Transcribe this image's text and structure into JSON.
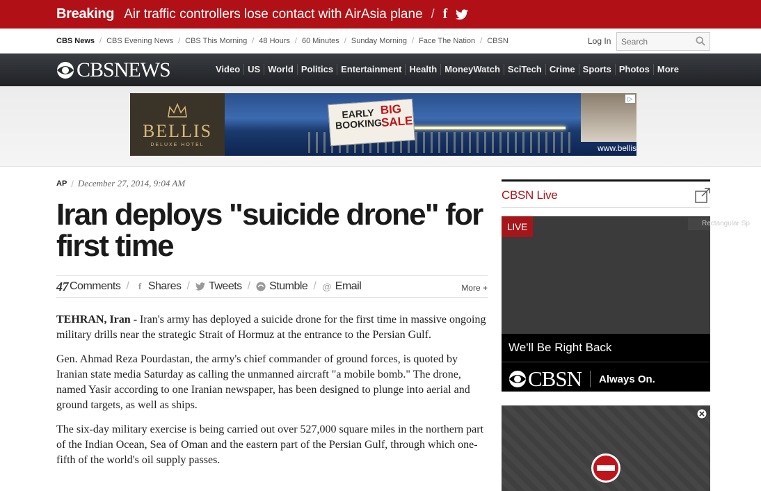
{
  "breaking": {
    "label": "Breaking",
    "headline": "Air traffic controllers lose contact with AirAsia plane",
    "separator": "/",
    "facebook_glyph": "f",
    "twitter_icon": "twitter-icon"
  },
  "topnav": {
    "links": [
      "CBS News",
      "CBS Evening News",
      "CBS This Morning",
      "48 Hours",
      "60 Minutes",
      "Sunday Morning",
      "Face The Nation",
      "CBSN"
    ],
    "login": "Log In",
    "search_placeholder": "Search"
  },
  "mainnav": {
    "logo": "CBSNEWS",
    "items": [
      "Video",
      "US",
      "World",
      "Politics",
      "Entertainment",
      "Health",
      "MoneyWatch",
      "SciTech",
      "Crime",
      "Sports",
      "Photos",
      "More"
    ]
  },
  "ad": {
    "brand": "BELLIS",
    "brand_sub": "DELUXE HOTEL",
    "tag_line1": "EARLY",
    "tag_line2": "BOOKING",
    "tag_big1": "BIG",
    "tag_big2": "SALE",
    "site": "www.bellis.com.tr",
    "adchoice": "▷"
  },
  "article": {
    "source": "AP",
    "date": "December 27, 2014, 9:04 AM",
    "title": "Iran deploys \"suicide drone\" for first time",
    "share": {
      "comment_count": "47",
      "comments": "Comments",
      "shares": "Shares",
      "tweets": "Tweets",
      "stumble": "Stumble",
      "email": "Email",
      "more": "More +"
    },
    "dateline": "TEHRAN, Iran",
    "p1": " - Iran's army has deployed a suicide drone for the first time in massive ongoing military drills near the strategic Strait of Hormuz at the entrance to the Persian Gulf.",
    "p2": "Gen. Ahmad Reza Pourdastan, the army's chief commander of ground forces, is quoted by Iranian state media Saturday as calling the unmanned aircraft \"a mobile bomb.\" The drone, named Yasir according to one Iranian newspaper, has been designed to plunge into aerial and ground targets, as well as ships.",
    "p3": "The six-day military exercise is being carried out over 527,000 square miles in the northern part of the Indian Ocean, Sea of Oman and the eastern part of the Persian Gulf, through which one-fifth of the world's oil supply passes."
  },
  "sidebar": {
    "cbsn_title": "CBSN Live",
    "live": "LIVE",
    "right_back": "We'll Be Right Back",
    "cbsn_logo": "CBSN",
    "slogan": "Always On.",
    "rect_label": "Rectangular Sp"
  },
  "colors": {
    "brand_red": "#b11116",
    "nav_dark": "#2a2c30"
  }
}
